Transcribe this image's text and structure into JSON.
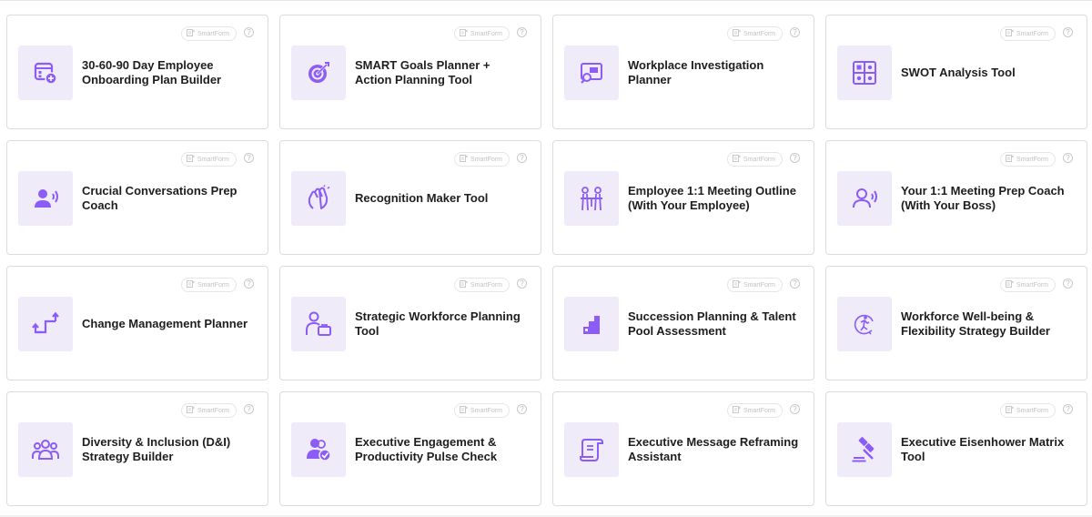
{
  "accent_color": "#8b5cf6",
  "badge_label": "SmartForm",
  "help_glyph": "?",
  "cards": [
    {
      "title": "30-60-90 Day Employee Onboarding Plan Builder",
      "icon": "calendar-plus-icon"
    },
    {
      "title": "SMART Goals Planner + Action Planning Tool",
      "icon": "target-dart-icon"
    },
    {
      "title": "Workplace Investigation Planner",
      "icon": "magnifier-board-icon"
    },
    {
      "title": "SWOT Analysis Tool",
      "icon": "grid-four-icon"
    },
    {
      "title": "Crucial Conversations Prep Coach",
      "icon": "user-speaking-icon"
    },
    {
      "title": "Recognition Maker Tool",
      "icon": "clapping-hands-icon"
    },
    {
      "title": "Employee 1:1 Meeting Outline (With Your Employee)",
      "icon": "meeting-table-icon"
    },
    {
      "title": "Your 1:1 Meeting Prep Coach (With Your Boss)",
      "icon": "user-voice-outline-icon"
    },
    {
      "title": "Change Management Planner",
      "icon": "change-arrows-icon"
    },
    {
      "title": "Strategic Workforce Planning Tool",
      "icon": "user-briefcase-icon"
    },
    {
      "title": "Succession Planning & Talent Pool Assessment",
      "icon": "stairs-icon"
    },
    {
      "title": "Workforce Well-being & Flexibility Strategy Builder",
      "icon": "wellbeing-runner-icon"
    },
    {
      "title": "Diversity & Inclusion (D&I) Strategy Builder",
      "icon": "group-people-icon"
    },
    {
      "title": "Executive Engagement & Productivity Pulse Check",
      "icon": "users-check-icon"
    },
    {
      "title": "Executive Message Reframing Assistant",
      "icon": "scroll-document-icon"
    },
    {
      "title": "Executive Eisenhower Matrix Tool",
      "icon": "gavel-icon"
    }
  ]
}
